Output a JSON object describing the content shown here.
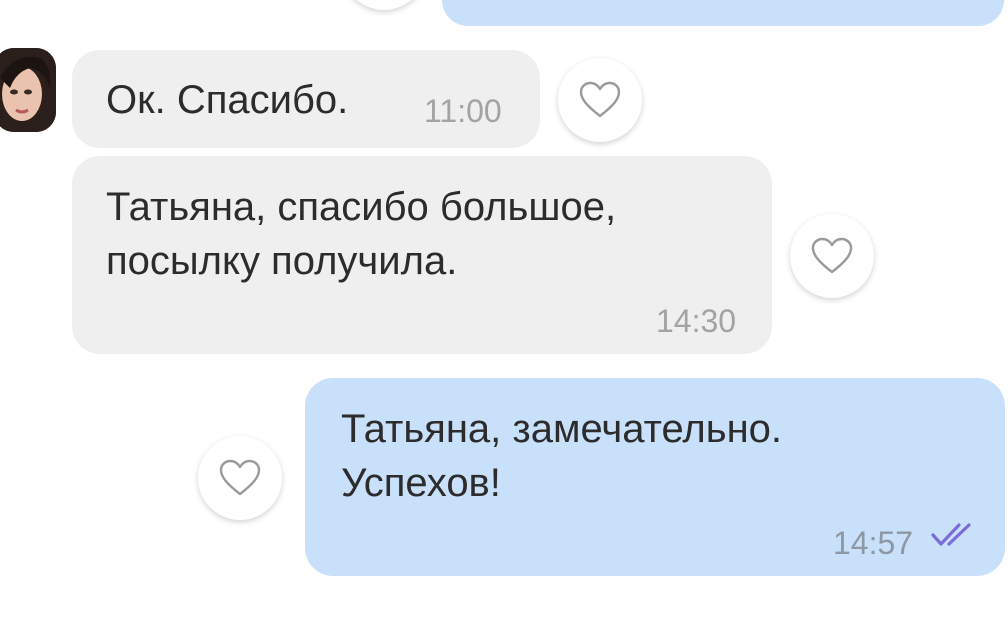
{
  "messages": [
    {
      "direction": "outgoing",
      "text": "",
      "time": ""
    },
    {
      "direction": "incoming",
      "text": "Ок. Спасибо.",
      "time": "11:00",
      "like_icon": "heart-outline-icon"
    },
    {
      "direction": "incoming",
      "lines": [
        "Татьяна, спасибо большое,",
        "посылку получила."
      ],
      "time": "14:30",
      "like_icon": "heart-outline-icon"
    },
    {
      "direction": "outgoing",
      "lines": [
        "Татьяна, замечательно.",
        "Успехов!"
      ],
      "time": "14:57",
      "status_icon": "double-check-read-icon",
      "like_icon": "heart-outline-icon"
    }
  ],
  "contact": {
    "avatar_icon": "contact-avatar"
  },
  "colors": {
    "incoming_bubble": "#efefef",
    "outgoing_bubble": "#c9e0fb",
    "read_check": "#7b6cd9"
  }
}
